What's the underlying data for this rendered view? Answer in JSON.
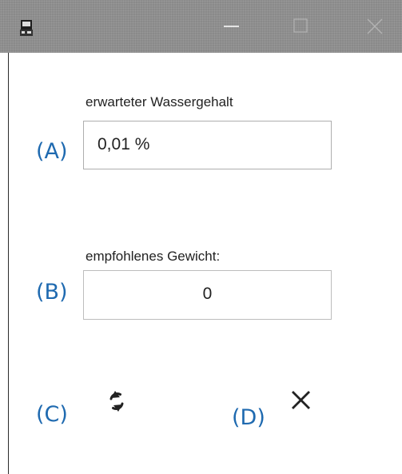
{
  "titlebar": {
    "icons": {
      "app": "app-icon",
      "minimize": "minimize-icon",
      "maximize": "maximize-icon",
      "close": "close-icon"
    }
  },
  "water_content": {
    "label": "erwarteter Wassergehalt",
    "value": "0,01 %",
    "marker": "(A)"
  },
  "recommended_weight": {
    "label": "empfohlenes Gewicht:",
    "value": "0",
    "marker": "(B)"
  },
  "actions": {
    "refresh": {
      "icon": "refresh-icon",
      "marker": "(C)"
    },
    "cancel": {
      "icon": "close-icon",
      "marker": "(D)"
    }
  },
  "colors": {
    "titlebar": "#8a8a8a",
    "marker": "#1f6ab0",
    "field_border": "#aeaeae"
  }
}
